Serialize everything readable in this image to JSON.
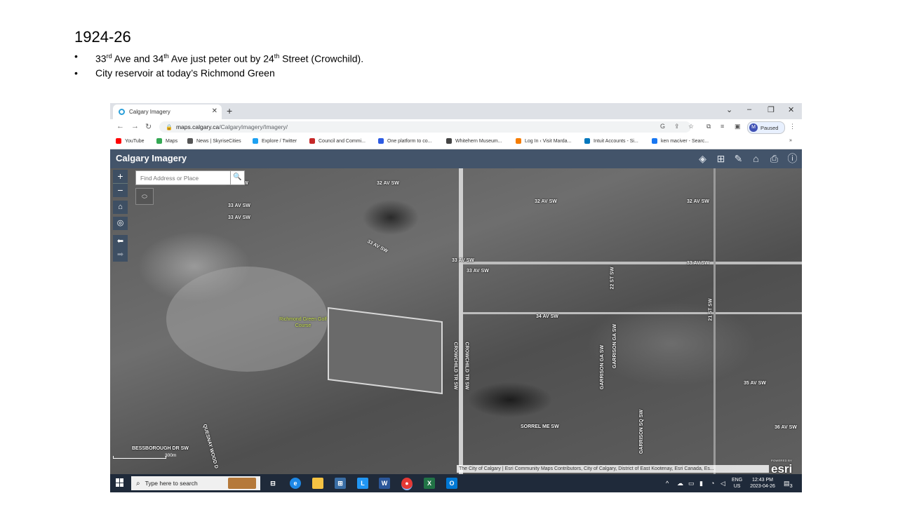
{
  "slide": {
    "title": "1924-26",
    "bullets": [
      {
        "pre": "33",
        "sup1": "rd",
        "mid1": " Ave and 34",
        "sup2": "th",
        "mid2": " Ave just peter out by 24",
        "sup3": "th",
        "post": " Street (Crowchild)."
      },
      {
        "text": "City reservoir at today’s Richmond Green"
      }
    ]
  },
  "browser": {
    "tab_title": "Calgary Imagery",
    "new_tab": "+",
    "url_host": "maps.calgary.ca",
    "url_path": "/CalgaryImagery/Imagery/",
    "profile_initial": "M",
    "profile_status": "Paused",
    "bookmarks": [
      {
        "label": "YouTube",
        "color": "#ff0000"
      },
      {
        "label": "Maps",
        "color": "#34a853"
      },
      {
        "label": "News | SkyriseCities",
        "color": "#555555"
      },
      {
        "label": "Explore / Twitter",
        "color": "#1da1f2"
      },
      {
        "label": "Council and Commi...",
        "color": "#c62828"
      },
      {
        "label": "One platform to co...",
        "color": "#2d5be3"
      },
      {
        "label": "Whitehern Museum...",
        "color": "#444444"
      },
      {
        "label": "Log In ‹ Visit Marda...",
        "color": "#f57c00"
      },
      {
        "label": "Intuit Accounts - Si...",
        "color": "#0277bd"
      },
      {
        "label": "ken maciver - Searc...",
        "color": "#1877f2"
      }
    ],
    "bookmarks_more": "»"
  },
  "app": {
    "title": "Calgary Imagery",
    "header_icons": [
      "layers-icon",
      "swipe-icon",
      "measure-icon",
      "education-icon",
      "print-icon",
      "info-icon"
    ]
  },
  "map": {
    "search_placeholder": "Find Address or Place",
    "zoom_in": "+",
    "zoom_out": "−",
    "streets": [
      {
        "label": "32 AV SW"
      },
      {
        "label": "32 AV SW"
      },
      {
        "label": "32 AV SW"
      },
      {
        "label": "32 AV SW"
      },
      {
        "label": "33 AV SW"
      },
      {
        "label": "33 AV SW"
      },
      {
        "label": "33 AV SW"
      },
      {
        "label": "33 AV SW"
      },
      {
        "label": "33 AV SW"
      },
      {
        "label": "33 AV SW"
      },
      {
        "label": "34 AV SW"
      },
      {
        "label": "22 ST SW"
      },
      {
        "label": "21 ST SW"
      },
      {
        "label": "CROWCHILD TR SW"
      },
      {
        "label": "CROWCHILD TR SW"
      },
      {
        "label": "GARRISON GA SW"
      },
      {
        "label": "GARRISON GA SW"
      },
      {
        "label": "GARRISON SQ SW"
      },
      {
        "label": "35 AV SW"
      },
      {
        "label": "36 AV SW"
      },
      {
        "label": "SORREL ME SW"
      },
      {
        "label": "QUESNAY WOOD D"
      },
      {
        "label": "BESSBOROUGH DR SW"
      }
    ],
    "poi_label": "Richmond Green Golf Course",
    "scale_label": "300m",
    "attribution": "The City of Calgary | Esri Community Maps Contributors, City of Calgary, District of East Kootenay, Esri Canada, Es...",
    "esri_powered": "POWERED BY",
    "esri_logo": "esri"
  },
  "taskbar": {
    "search_placeholder": "Type here to search",
    "lang_top": "ENG",
    "lang_bottom": "US",
    "time": "12:43 PM",
    "date": "2023-04-26",
    "notifications": "3",
    "app_colors": {
      "edge": "#1e88e5",
      "explorer": "#f6c343",
      "store": "#3a6ea5",
      "l_app": "#2196f3",
      "word": "#2b579a",
      "chrome": "#e53935",
      "excel": "#217346",
      "outlook": "#0078d4"
    }
  }
}
